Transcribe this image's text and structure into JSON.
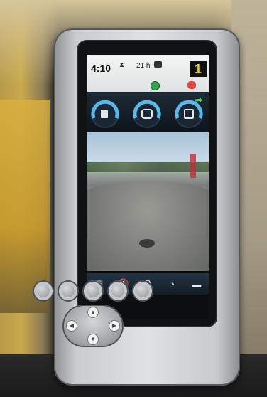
{
  "status_bar": {
    "time": "4:10",
    "hourglass_icon": "⧗",
    "hours": "21 h",
    "gear": "1"
  },
  "gauges": [
    {
      "name": "fuel-gauge",
      "icon": "fuel-pump-icon",
      "symbol": "⛽"
    },
    {
      "name": "coolant-gauge",
      "icon": "engine-temp-icon",
      "symbol": "🌡"
    },
    {
      "name": "hydraulic-gauge",
      "icon": "hydraulic-oil-icon",
      "symbol": "⊡"
    }
  ],
  "softkeys": [
    {
      "name": "menu-softkey",
      "icon": "document-icon",
      "symbol": "▤"
    },
    {
      "name": "mute-softkey",
      "icon": "mute-icon",
      "symbol": "🔇"
    },
    {
      "name": "operator-softkey",
      "icon": "operator-icon",
      "symbol": "⚲"
    },
    {
      "name": "speed-softkey",
      "icon": "speedometer-icon",
      "symbol": "◔"
    },
    {
      "name": "camera-softkey",
      "icon": "camera-icon",
      "symbol": "▬"
    }
  ],
  "colors": {
    "gear_text": "#f0d20a",
    "indicator_green": "#2fa54a",
    "indicator_red": "#e24848",
    "gauge_arc": "#5ab8e8"
  }
}
